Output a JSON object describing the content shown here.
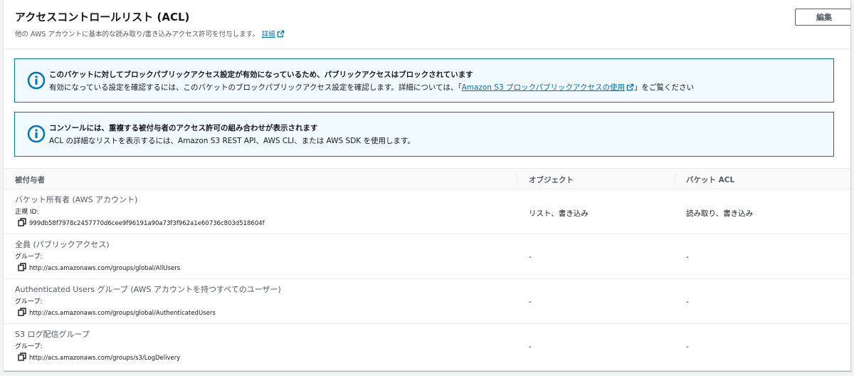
{
  "header": {
    "title": "アクセスコントロールリスト (ACL)",
    "description": "他の AWS アカウントに基本的な読み取り/書き込みアクセス許可を付与します。",
    "details_link": "詳細",
    "edit_label": "編集"
  },
  "alerts": [
    {
      "title": "このバケットに対してブロックパブリックアクセス設定が有効になっているため、パブリックアクセスはブロックされています",
      "body_prefix": "有効になっている設定を確認するには、このバケットのブロックパブリックアクセス設定を確認します。詳細については、「",
      "link": "Amazon S3 ブロックパブリックアクセスの使用",
      "body_suffix": "」をご覧ください"
    },
    {
      "title": "コンソールには、重複する被付与者のアクセス許可の組み合わせが表示されます",
      "body": "ACL の詳細なリストを表示するには、Amazon S3 REST API、AWS CLI、または AWS SDK を使用します。"
    }
  ],
  "table": {
    "columns": [
      "被付与者",
      "オブジェクト",
      "バケット ACL"
    ],
    "rows": [
      {
        "name": "バケット所有者 (AWS アカウント)",
        "type": "正規 ID:",
        "id": "999db58f7978c2457770d6cee9f96191a90a73f3f962a1e60736c803d518604f",
        "objects": "リスト、書き込み",
        "bucket_acl": "読み取り、書き込み"
      },
      {
        "name": "全員 (パブリックアクセス)",
        "type": "グループ:",
        "id": "http://acs.amazonaws.com/groups/global/AllUsers",
        "objects": "-",
        "bucket_acl": "-"
      },
      {
        "name": "Authenticated Users グループ (AWS アカウントを持つすべてのユーザー)",
        "type": "グループ:",
        "id": "http://acs.amazonaws.com/groups/global/AuthenticatedUsers",
        "objects": "-",
        "bucket_acl": "-"
      },
      {
        "name": "S3 ログ配信グループ",
        "type": "グループ:",
        "id": "http://acs.amazonaws.com/groups/s3/LogDelivery",
        "objects": "-",
        "bucket_acl": "-"
      }
    ]
  },
  "icons": {
    "info": "info-icon",
    "external": "external-link-icon",
    "copy": "copy-icon"
  },
  "colors": {
    "link": "#0073bb",
    "alert_bg": "#f1faff",
    "alert_border": "#0073bb",
    "text": "#16191f",
    "muted": "#545b64"
  }
}
